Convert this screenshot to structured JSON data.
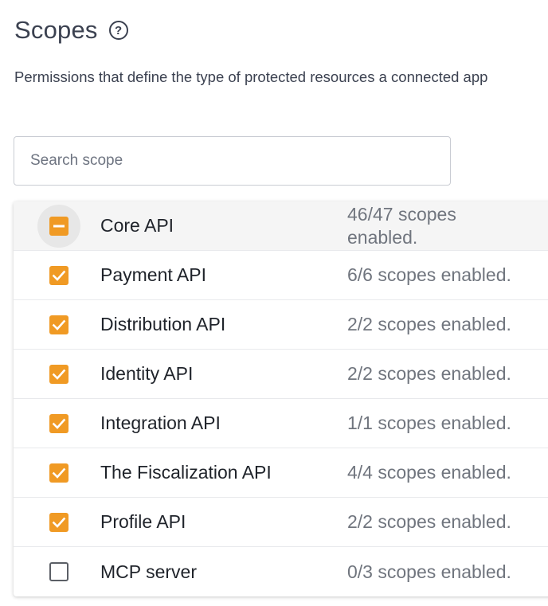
{
  "header": {
    "title": "Scopes",
    "help_icon": "question-circle-icon",
    "description": "Permissions that define the type of protected resources a connected app"
  },
  "search": {
    "placeholder": "Search scope",
    "value": ""
  },
  "colors": {
    "accent": "#f09a24",
    "header_row_bg": "#f5f5f5"
  },
  "scopes": [
    {
      "label": "Core API",
      "status": "46/47 scopes enabled.",
      "state": "partial"
    },
    {
      "label": "Payment API",
      "status": "6/6 scopes enabled.",
      "state": "checked"
    },
    {
      "label": "Distribution API",
      "status": "2/2 scopes enabled.",
      "state": "checked"
    },
    {
      "label": "Identity API",
      "status": "2/2 scopes enabled.",
      "state": "checked"
    },
    {
      "label": "Integration API",
      "status": "1/1 scopes enabled.",
      "state": "checked"
    },
    {
      "label": "The Fiscalization API",
      "status": "4/4 scopes enabled.",
      "state": "checked"
    },
    {
      "label": "Profile API",
      "status": "2/2 scopes enabled.",
      "state": "checked"
    },
    {
      "label": "MCP server",
      "status": "0/3 scopes enabled.",
      "state": "unchecked"
    }
  ]
}
